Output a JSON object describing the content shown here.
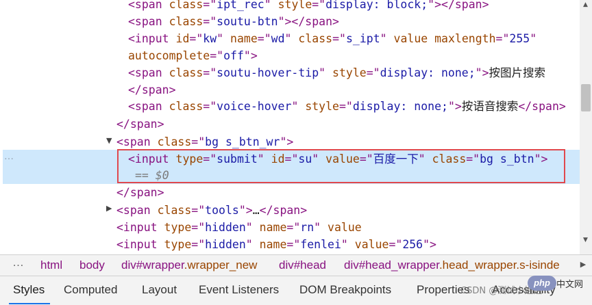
{
  "code_lines": [
    {
      "parts": [
        [
          "t",
          "<span "
        ],
        [
          "a",
          "class"
        ],
        [
          "t",
          "=\""
        ],
        [
          "v",
          "ipt_rec"
        ],
        [
          "t",
          "\" "
        ],
        [
          "a",
          "style"
        ],
        [
          "t",
          "=\""
        ],
        [
          "v",
          "display: block;"
        ],
        [
          "t",
          "\"></span>"
        ]
      ]
    },
    {
      "parts": [
        [
          "t",
          "<span "
        ],
        [
          "a",
          "class"
        ],
        [
          "t",
          "=\""
        ],
        [
          "v",
          "soutu-btn"
        ],
        [
          "t",
          "\"></span>"
        ]
      ]
    },
    {
      "parts": [
        [
          "t",
          "<input "
        ],
        [
          "a",
          "id"
        ],
        [
          "t",
          "=\""
        ],
        [
          "v",
          "kw"
        ],
        [
          "t",
          "\" "
        ],
        [
          "a",
          "name"
        ],
        [
          "t",
          "=\""
        ],
        [
          "v",
          "wd"
        ],
        [
          "t",
          "\" "
        ],
        [
          "a",
          "class"
        ],
        [
          "t",
          "=\""
        ],
        [
          "v",
          "s_ipt"
        ],
        [
          "t",
          "\" "
        ],
        [
          "a",
          "value"
        ],
        [
          "t",
          " "
        ],
        [
          "a",
          "maxlength"
        ],
        [
          "t",
          "=\""
        ],
        [
          "v",
          "255"
        ],
        [
          "t",
          "\""
        ]
      ]
    },
    {
      "parts": [
        [
          "a",
          "autocomplete"
        ],
        [
          "t",
          "=\""
        ],
        [
          "v",
          "off"
        ],
        [
          "t",
          "\">"
        ]
      ]
    },
    {
      "parts": [
        [
          "t",
          "<span "
        ],
        [
          "a",
          "class"
        ],
        [
          "t",
          "=\""
        ],
        [
          "v",
          "soutu-hover-tip"
        ],
        [
          "t",
          "\" "
        ],
        [
          "a",
          "style"
        ],
        [
          "t",
          "=\""
        ],
        [
          "v",
          "display: none;"
        ],
        [
          "t",
          "\">"
        ],
        [
          "x",
          "按图片搜索"
        ]
      ]
    },
    {
      "parts": [
        [
          "t",
          "</span>"
        ]
      ]
    },
    {
      "parts": [
        [
          "t",
          "<span "
        ],
        [
          "a",
          "class"
        ],
        [
          "t",
          "=\""
        ],
        [
          "v",
          "voice-hover"
        ],
        [
          "t",
          "\" "
        ],
        [
          "a",
          "style"
        ],
        [
          "t",
          "=\""
        ],
        [
          "v",
          "display: none;"
        ],
        [
          "t",
          "\">"
        ],
        [
          "x",
          "按语音搜索"
        ],
        [
          "t",
          "</span>"
        ]
      ]
    },
    {
      "parts": [
        [
          "t",
          "</span>"
        ]
      ]
    },
    {
      "parts": [
        [
          "t",
          "<span "
        ],
        [
          "a",
          "class"
        ],
        [
          "t",
          "=\""
        ],
        [
          "v",
          "bg s_btn_wr"
        ],
        [
          "t",
          "\">"
        ]
      ]
    },
    {
      "parts": [
        [
          "t",
          "<input "
        ],
        [
          "a",
          "type"
        ],
        [
          "t",
          "=\""
        ],
        [
          "v",
          "submit"
        ],
        [
          "t",
          "\" "
        ],
        [
          "a",
          "id"
        ],
        [
          "t",
          "=\""
        ],
        [
          "v",
          "su"
        ],
        [
          "t",
          "\" "
        ],
        [
          "a",
          "value"
        ],
        [
          "t",
          "=\""
        ],
        [
          "v",
          "百度一下"
        ],
        [
          "t",
          "\" "
        ],
        [
          "a",
          "class"
        ],
        [
          "t",
          "=\""
        ],
        [
          "v",
          "bg s_btn"
        ],
        [
          "t",
          "\">"
        ]
      ]
    },
    {
      "parts": [
        [
          "eq",
          "== $0"
        ]
      ]
    },
    {
      "parts": [
        [
          "t",
          "</span>"
        ]
      ]
    },
    {
      "parts": [
        [
          "t",
          "<span "
        ],
        [
          "a",
          "class"
        ],
        [
          "t",
          "=\""
        ],
        [
          "v",
          "tools"
        ],
        [
          "t",
          "\">"
        ],
        [
          "x",
          "…"
        ],
        [
          "t",
          "</span>"
        ]
      ]
    },
    {
      "parts": [
        [
          "t",
          "<input "
        ],
        [
          "a",
          "type"
        ],
        [
          "t",
          "=\""
        ],
        [
          "v",
          "hidden"
        ],
        [
          "t",
          "\" "
        ],
        [
          "a",
          "name"
        ],
        [
          "t",
          "=\""
        ],
        [
          "v",
          "rn"
        ],
        [
          "t",
          "\" "
        ],
        [
          "a",
          "value"
        ]
      ]
    },
    {
      "parts": [
        [
          "t",
          "<input "
        ],
        [
          "a",
          "type"
        ],
        [
          "t",
          "=\""
        ],
        [
          "v",
          "hidden"
        ],
        [
          "t",
          "\" "
        ],
        [
          "a",
          "name"
        ],
        [
          "t",
          "=\""
        ],
        [
          "v",
          "fenlei"
        ],
        [
          "t",
          "\" "
        ],
        [
          "a",
          "value"
        ],
        [
          "t",
          "=\""
        ],
        [
          "v",
          "256"
        ],
        [
          "t",
          "\">"
        ]
      ]
    }
  ],
  "selected_marker": "…",
  "breadcrumbs": {
    "more": "…",
    "items": [
      {
        "tag": "html",
        "cls": ""
      },
      {
        "tag": "body",
        "cls": ""
      },
      {
        "tag": "div#wrapper",
        "cls": ".wrapper_new"
      },
      {
        "tag": "div#head",
        "cls": ""
      },
      {
        "tag": "div#head_wrapper",
        "cls": ".head_wrapper.s-isinde"
      }
    ]
  },
  "tabs": [
    "Styles",
    "Computed",
    "Layout",
    "Event Listeners",
    "DOM Breakpoints",
    "Properties",
    "Accessibility"
  ],
  "active_tab": "Styles",
  "watermark": "CSDN @测试小姐姐",
  "logo_text": "php",
  "logo_suffix": "中文网"
}
